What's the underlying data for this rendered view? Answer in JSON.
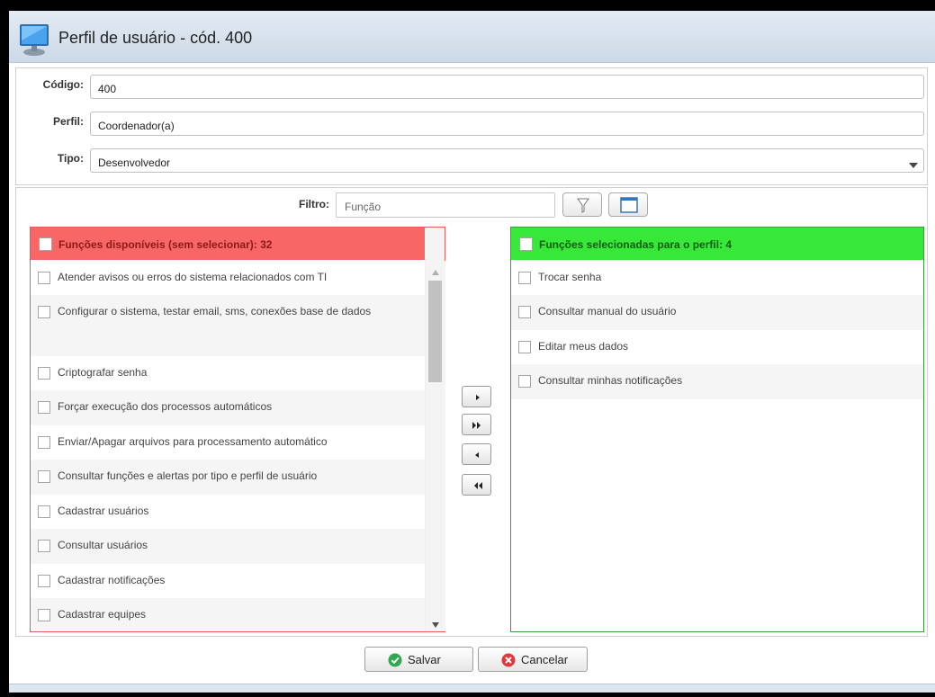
{
  "window": {
    "title": "Perfil de usuário - cód. 400"
  },
  "form": {
    "codigo": {
      "label": "Código:",
      "value": "400"
    },
    "perfil": {
      "label": "Perfil:",
      "value": "Coordenador(a)"
    },
    "tipo": {
      "label": "Tipo:",
      "value": "Desenvolvedor"
    }
  },
  "filter": {
    "label": "Filtro:",
    "placeholder": "Função"
  },
  "available": {
    "header": "Funções disponíveis (sem selecionar): 32",
    "items": [
      {
        "label": "Atender avisos ou erros do sistema relacionados com TI"
      },
      {
        "label": "Configurar o sistema, testar email, sms, conexões base de dados"
      },
      {
        "label": "Criptografar senha"
      },
      {
        "label": "Forçar execução dos processos automáticos"
      },
      {
        "label": "Enviar/Apagar arquivos para processamento automático"
      },
      {
        "label": "Consultar funções e alertas por tipo e perfil de usuário"
      },
      {
        "label": "Cadastrar usuários"
      },
      {
        "label": "Consultar usuários"
      },
      {
        "label": "Cadastrar notificações"
      },
      {
        "label": "Cadastrar equipes"
      }
    ]
  },
  "selected": {
    "header": "Funções selecionadas para o perfil: 4",
    "items": [
      {
        "label": "Trocar senha"
      },
      {
        "label": "Consultar manual do usuário"
      },
      {
        "label": "Editar meus dados"
      },
      {
        "label": "Consultar minhas notificações"
      }
    ]
  },
  "buttons": {
    "save": "Salvar",
    "cancel": "Cancelar"
  },
  "colors": {
    "available_header": "#f86666",
    "selected_header": "#38e838",
    "save_icon": "#2fa84f",
    "cancel_icon": "#e0393e"
  },
  "icons": {
    "title": "monitor-icon",
    "filter": "funnel-icon",
    "window": "window-icon",
    "save": "check-circle-icon",
    "cancel": "x-circle-icon"
  }
}
